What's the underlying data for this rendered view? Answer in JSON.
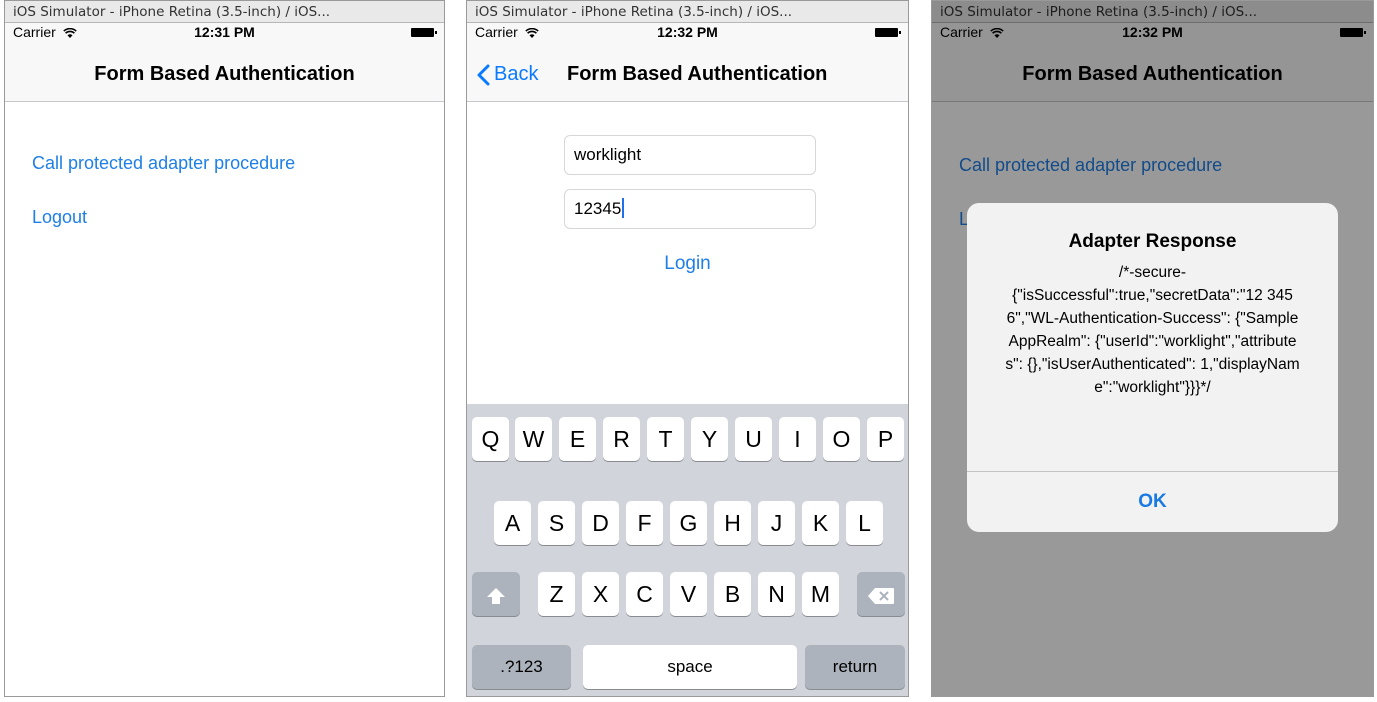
{
  "window_title": "iOS Simulator - iPhone Retina (3.5-inch) / iOS...",
  "carrier": "Carrier",
  "nav_title": "Form Based Authentication",
  "screens": [
    {
      "time": "12:31 PM",
      "links": {
        "call_procedure": "Call protected adapter procedure",
        "logout": "Logout"
      }
    },
    {
      "time": "12:32 PM",
      "back_label": "Back",
      "username_value": "worklight",
      "password_value": "12345",
      "login_label": "Login",
      "keyboard": {
        "row1": [
          "Q",
          "W",
          "E",
          "R",
          "T",
          "Y",
          "U",
          "I",
          "O",
          "P"
        ],
        "row2": [
          "A",
          "S",
          "D",
          "F",
          "G",
          "H",
          "J",
          "K",
          "L"
        ],
        "row3": [
          "Z",
          "X",
          "C",
          "V",
          "B",
          "N",
          "M"
        ],
        "numbers_label": ".?123",
        "space_label": "space",
        "return_label": "return"
      }
    },
    {
      "time": "12:32 PM",
      "link_call_procedure": "Call protected adapter procedure",
      "link_logout_partial": "L",
      "alert": {
        "title": "Adapter Response",
        "message": "/*-secure-\n{\"isSuccessful\":true,\"secretData\":\"12 3456\",\"WL-Authentication-Success\": {\"SampleAppRealm\": {\"userId\":\"worklight\",\"attributes\": {},\"isUserAuthenticated\": 1,\"displayName\":\"worklight\"}}}*/",
        "ok_label": "OK"
      }
    }
  ],
  "colors": {
    "link": "#1e7fe6",
    "keyboard_bg": "#d1d5db",
    "key_dark": "#acb3bc"
  }
}
